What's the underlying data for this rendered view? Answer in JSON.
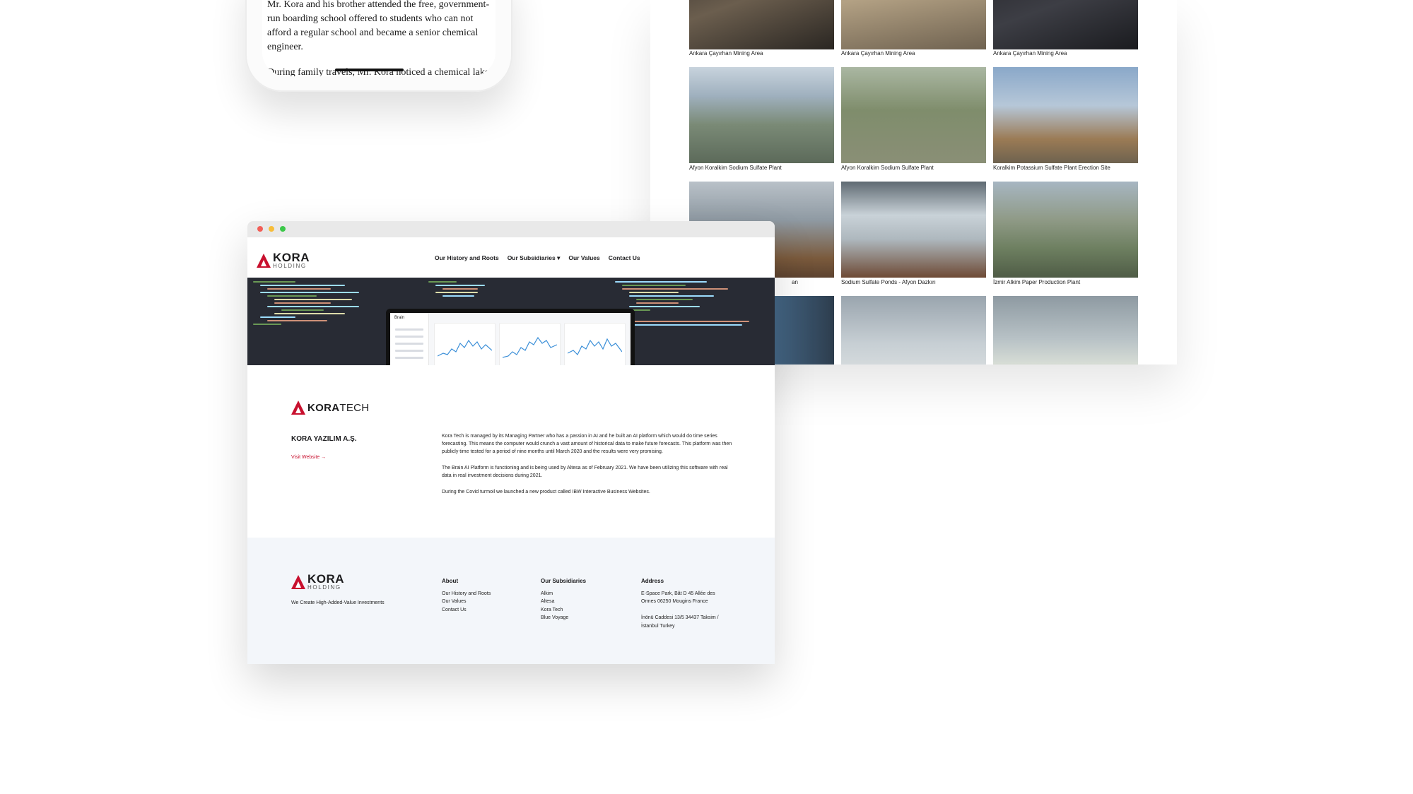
{
  "phone": {
    "paragraph1": "Mr. Kora and his brother attended the free, government-run boarding school offered to students who can not afford a regular school and became a senior chemical engineer.",
    "paragraph2": "During family travels, Mr. Kora noticed a chemical lake"
  },
  "gallery": {
    "row1": [
      "Ankara Çayırhan Mining Area",
      "Ankara Çayırhan Mining Area",
      "Ankara Çayırhan Mining Area"
    ],
    "row2": [
      "Afyon Koralkim Sodium Sulfate Plant",
      "Afyon Koralkim Sodium Sulfate Plant",
      "Koralkim Potassium Sulfate Plant Erection Site"
    ],
    "row3": [
      "an",
      "Sodium Sulfate Ponds - Afyon Dazkırı",
      "İzmir Alkim Paper Production Plant"
    ]
  },
  "site": {
    "logo_main": "KORA",
    "logo_sub": "HOLDING",
    "nav": [
      "Our History and Roots",
      "Our Subsidiaries ▾",
      "Our Values",
      "Contact Us"
    ]
  },
  "hero": {
    "app_brand": "Brain"
  },
  "subsidiary": {
    "logo_bold": "KORA",
    "logo_light": "TECH",
    "title": "KORA YAZILIM A.Ş.",
    "visit": "Visit Website →",
    "p1": "Kora Tech is managed by its Managing Partner who has a passion in AI and he built an AI platform which would do time series forecasting. This means the computer would crunch a vast amount of historical data to make future forecasts. This platform was then publicly time tested for a period of nine months until March 2020 and the results were very promising.",
    "p2": "The Brain AI Platform is functioning and is being used by Altesa as of February 2021. We have been utilizing this software with real data in real investment decisions during 2021.",
    "p3": "During the Covid turmoil we launched a new product called IBW Interactive Business Websites."
  },
  "footer": {
    "logo_main": "KORA",
    "logo_sub": "HOLDING",
    "tagline": "We Create High-Added-Value Investments",
    "about": {
      "title": "About",
      "items": [
        "Our History and Roots",
        "Our Values",
        "Contact Us"
      ]
    },
    "subsidiaries": {
      "title": "Our Subsidiaries",
      "items": [
        "Alkim",
        "Altesa",
        "Kora Tech",
        "Blue Voyage"
      ]
    },
    "address": {
      "title": "Address",
      "lines": [
        "E-Space Park, Bât D 45 Allée des",
        "Ormes 06250 Mougins France",
        "",
        "İnönü Caddesi 13/5 34437 Taksim /",
        "İstanbul Turkey"
      ]
    }
  },
  "colors": {
    "brand_red": "#c8102e",
    "hero_bg": "#282b34",
    "footer_bg": "#f3f6fa"
  }
}
